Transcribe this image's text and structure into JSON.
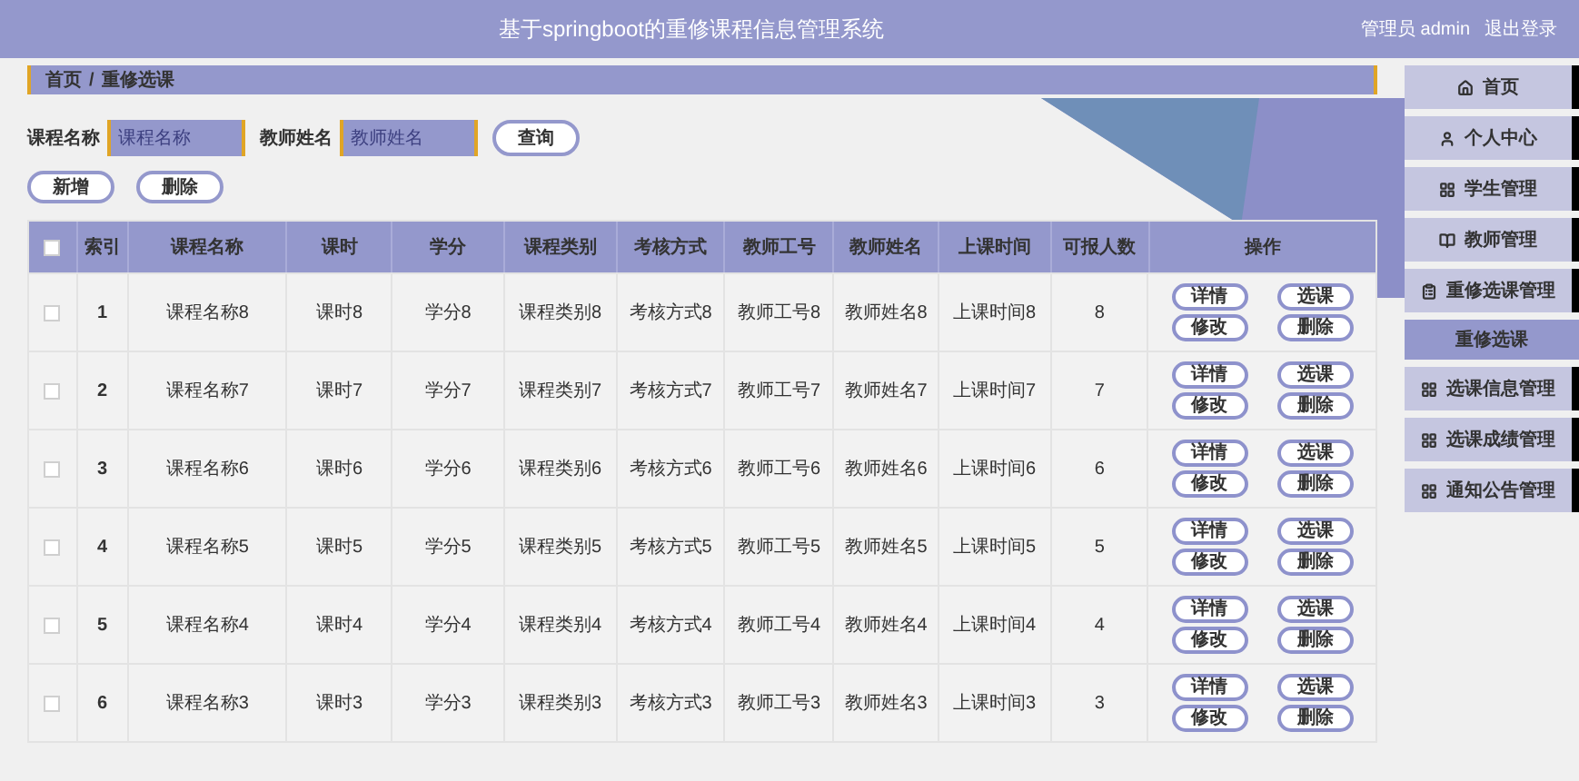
{
  "header": {
    "title": "基于springboot的重修课程信息管理系统",
    "user": "管理员 admin",
    "logout": "退出登录"
  },
  "breadcrumb": [
    "首页",
    "/",
    "重修选课"
  ],
  "search": {
    "fields": [
      {
        "label": "课程名称",
        "placeholder": "课程名称"
      },
      {
        "label": "教师姓名",
        "placeholder": "教师姓名"
      }
    ],
    "button": "查询"
  },
  "toolbar": [
    "新增",
    "删除"
  ],
  "table": {
    "header_checkbox": {
      "checked": false
    },
    "columns": [
      "索引",
      "课程名称",
      "课时",
      "学分",
      "课程类别",
      "考核方式",
      "教师工号",
      "教师姓名",
      "上课时间",
      "可报人数",
      "操作"
    ],
    "rows": [
      {
        "checked": false,
        "cells": [
          "1",
          "课程名称8",
          "课时8",
          "学分8",
          "课程类别8",
          "考核方式8",
          "教师工号8",
          "教师姓名8",
          "上课时间8",
          "8"
        ],
        "actions": [
          "详情",
          "选课",
          "修改",
          "删除"
        ]
      },
      {
        "checked": false,
        "cells": [
          "2",
          "课程名称7",
          "课时7",
          "学分7",
          "课程类别7",
          "考核方式7",
          "教师工号7",
          "教师姓名7",
          "上课时间7",
          "7"
        ],
        "actions": [
          "详情",
          "选课",
          "修改",
          "删除"
        ]
      },
      {
        "checked": false,
        "cells": [
          "3",
          "课程名称6",
          "课时6",
          "学分6",
          "课程类别6",
          "考核方式6",
          "教师工号6",
          "教师姓名6",
          "上课时间6",
          "6"
        ],
        "actions": [
          "详情",
          "选课",
          "修改",
          "删除"
        ]
      },
      {
        "checked": false,
        "cells": [
          "4",
          "课程名称5",
          "课时5",
          "学分5",
          "课程类别5",
          "考核方式5",
          "教师工号5",
          "教师姓名5",
          "上课时间5",
          "5"
        ],
        "actions": [
          "详情",
          "选课",
          "修改",
          "删除"
        ]
      },
      {
        "checked": false,
        "cells": [
          "5",
          "课程名称4",
          "课时4",
          "学分4",
          "课程类别4",
          "考核方式4",
          "教师工号4",
          "教师姓名4",
          "上课时间4",
          "4"
        ],
        "actions": [
          "详情",
          "选课",
          "修改",
          "删除"
        ]
      },
      {
        "checked": false,
        "cells": [
          "6",
          "课程名称3",
          "课时3",
          "学分3",
          "课程类别3",
          "考核方式3",
          "教师工号3",
          "教师姓名3",
          "上课时间3",
          "3"
        ],
        "actions": [
          "详情",
          "选课",
          "修改",
          "删除"
        ]
      }
    ]
  },
  "sidebar": {
    "items": [
      {
        "label": "首页",
        "selected": false
      },
      {
        "label": "个人中心",
        "selected": false
      },
      {
        "label": "学生管理",
        "selected": false
      },
      {
        "label": "教师管理",
        "selected": false
      },
      {
        "label": "重修选课管理",
        "selected": false,
        "children": [
          {
            "label": "重修选课",
            "selected": true
          }
        ]
      },
      {
        "label": "选课信息管理",
        "selected": false
      },
      {
        "label": "选课成绩管理",
        "selected": false
      },
      {
        "label": "通知公告管理",
        "selected": false
      }
    ]
  }
}
